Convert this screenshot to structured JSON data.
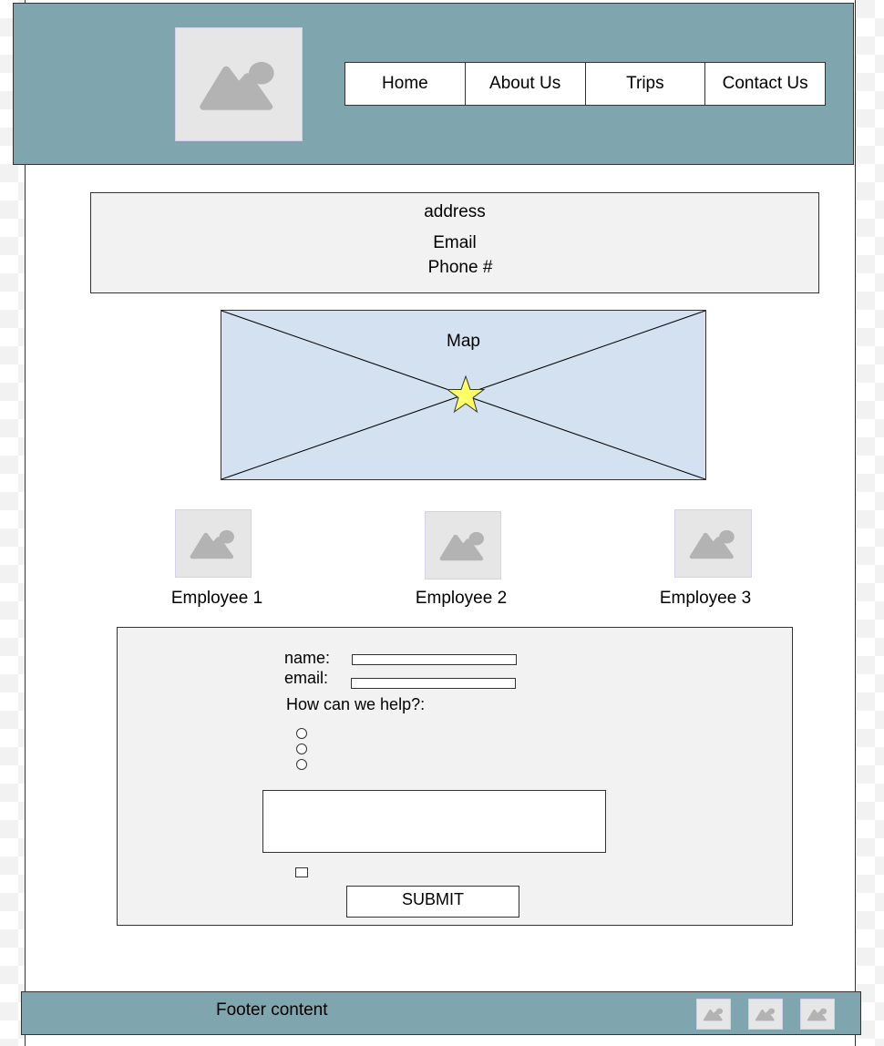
{
  "header": {
    "logo_icon": "image-placeholder-icon",
    "nav": [
      {
        "label": "Home"
      },
      {
        "label": "About Us"
      },
      {
        "label": "Trips"
      },
      {
        "label": "Contact Us"
      }
    ]
  },
  "contact_info": {
    "address": "address",
    "email": "Email",
    "phone": "Phone #"
  },
  "map": {
    "label": "Map",
    "marker_icon": "star-icon",
    "marker_color": "#ffff66"
  },
  "employees": [
    {
      "name": "Employee 1",
      "photo_icon": "image-placeholder-icon"
    },
    {
      "name": "Employee 2",
      "photo_icon": "image-placeholder-icon"
    },
    {
      "name": "Employee 3",
      "photo_icon": "image-placeholder-icon"
    }
  ],
  "form": {
    "name_label": "name:",
    "name_value": "",
    "email_label": "email:",
    "email_value": "",
    "help_label": "How can we help?:",
    "radio_count": 3,
    "message_value": "",
    "submit_label": "SUBMIT"
  },
  "footer": {
    "text": "Footer content",
    "social_icons": [
      "image-placeholder-icon",
      "image-placeholder-icon",
      "image-placeholder-icon"
    ]
  },
  "colors": {
    "header_bg": "#7fa5ae",
    "map_bg": "#d4e1f1",
    "panel_bg": "#f2f2f2",
    "placeholder_bg": "#e6e6e6",
    "placeholder_glyph": "#b3b3b3"
  }
}
